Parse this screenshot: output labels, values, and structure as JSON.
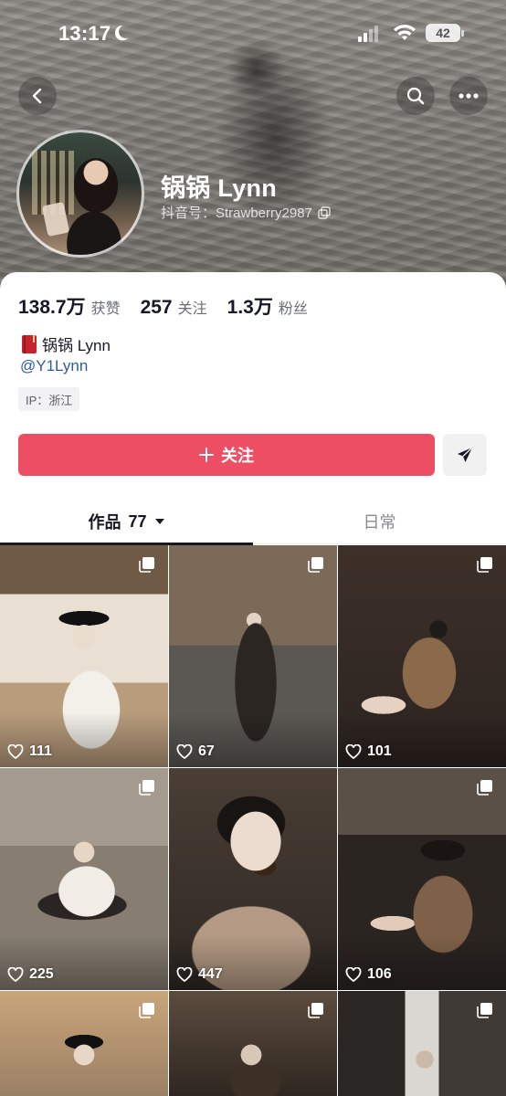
{
  "status_bar": {
    "time": "13:17",
    "battery": "42"
  },
  "profile": {
    "display_name": "锅锅 Lynn",
    "douyin_id": "抖音号：Strawberry2987"
  },
  "stats": [
    {
      "value": "138.7万",
      "label": "获赞"
    },
    {
      "value": "257",
      "label": "关注"
    },
    {
      "value": "1.3万",
      "label": "粉丝"
    }
  ],
  "bio": {
    "name_line": "锅锅 Lynn",
    "handle": "@Y1Lynn",
    "ip": "IP：浙江"
  },
  "actions": {
    "follow_label": "关注"
  },
  "tabs": {
    "works_label": "作品",
    "works_count": "77",
    "daily_label": "日常"
  },
  "posts": [
    {
      "likes": "111",
      "multi_image": true
    },
    {
      "likes": "67",
      "multi_image": true
    },
    {
      "likes": "101",
      "multi_image": true
    },
    {
      "likes": "225",
      "multi_image": true
    },
    {
      "likes": "447",
      "multi_image": false
    },
    {
      "likes": "106",
      "multi_image": true
    },
    {
      "likes": "",
      "multi_image": true
    },
    {
      "likes": "",
      "multi_image": true
    },
    {
      "likes": "",
      "multi_image": true
    }
  ],
  "colors": {
    "follow_button": "#ee4e64",
    "handle_link": "#2e5c9e",
    "text_primary": "#161823"
  }
}
